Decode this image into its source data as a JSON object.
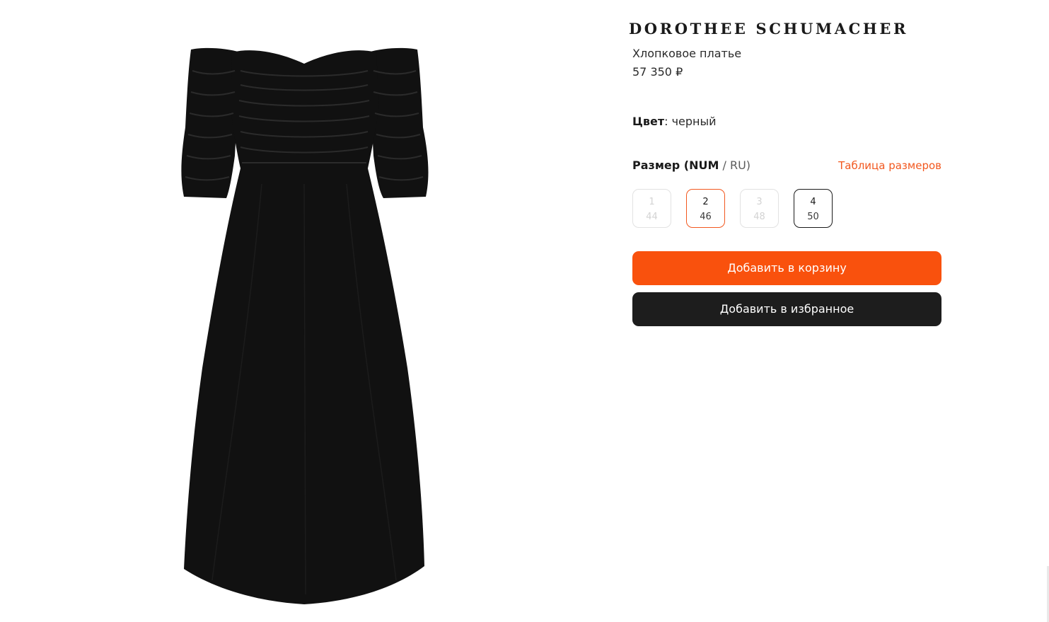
{
  "product": {
    "brand": "DOROTHEE SCHUMACHER",
    "title": "Хлопковое платье",
    "price": "57 350 ₽",
    "image_alt": "black-off-shoulder-dress"
  },
  "color": {
    "label": "Цвет",
    "separator": ": ",
    "value": "черный"
  },
  "size": {
    "label_strong": "Размер (NUM",
    "label_thin": " / RU)",
    "table_link": "Таблица размеров",
    "options": [
      {
        "num": "1",
        "ru": "44",
        "state": "unavailable"
      },
      {
        "num": "2",
        "ru": "46",
        "state": "selected"
      },
      {
        "num": "3",
        "ru": "48",
        "state": "unavailable"
      },
      {
        "num": "4",
        "ru": "50",
        "state": "available"
      }
    ]
  },
  "actions": {
    "add_to_cart": "Добавить в корзину",
    "add_to_favorites": "Добавить в избранное"
  },
  "colors": {
    "accent": "#f9510d",
    "dark_button": "#1d1d1d",
    "link": "#f2581f"
  }
}
